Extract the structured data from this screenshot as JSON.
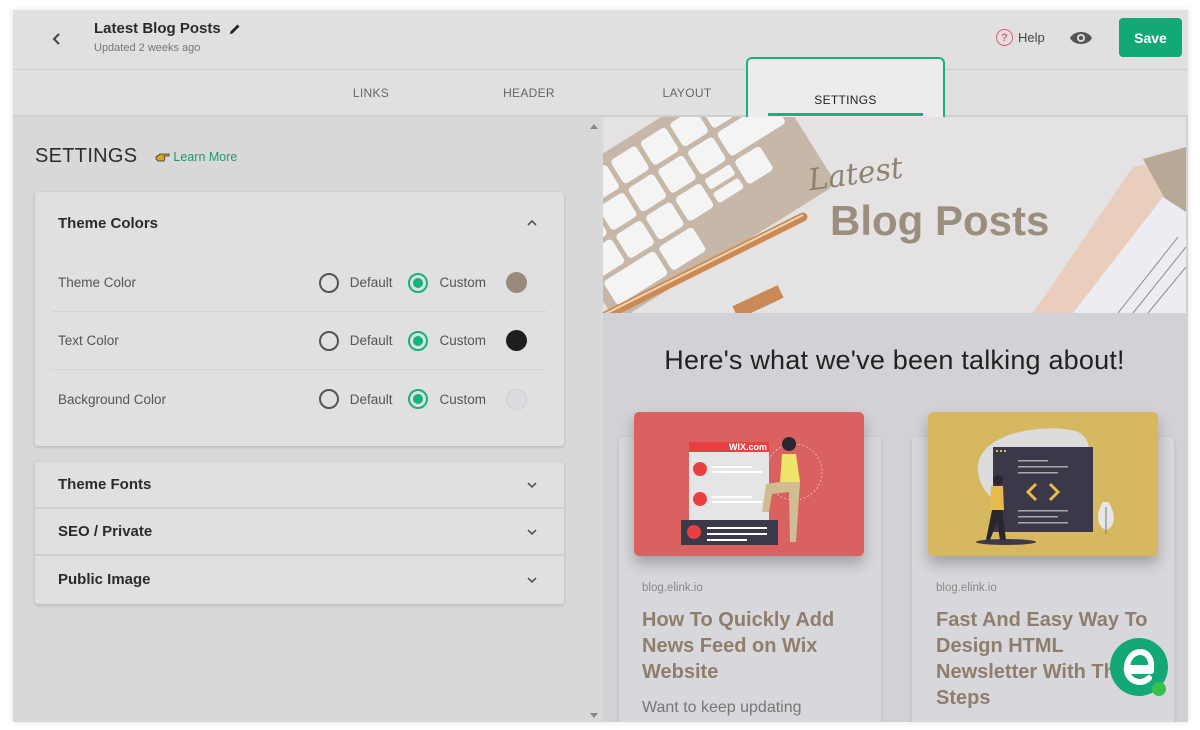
{
  "header": {
    "back_icon": "chevron-left-icon",
    "title": "Latest Blog Posts",
    "edit_icon": "pencil-icon",
    "updated": "Updated 2 weeks ago",
    "help_label": "Help",
    "help_icon": "question-circle-icon",
    "preview_icon": "eye-icon",
    "save_label": "Save"
  },
  "tabs": [
    {
      "label": "LINKS",
      "active": false
    },
    {
      "label": "HEADER",
      "active": false
    },
    {
      "label": "LAYOUT",
      "active": false
    },
    {
      "label": "SETTINGS",
      "active": true
    }
  ],
  "settings": {
    "title": "SETTINGS",
    "learn_more": "Learn More",
    "theme_colors": {
      "title": "Theme Colors",
      "expanded": true,
      "rows": [
        {
          "label": "Theme Color",
          "default_label": "Default",
          "custom_label": "Custom",
          "selected": "Custom",
          "swatch": "#9a8a7b"
        },
        {
          "label": "Text Color",
          "default_label": "Default",
          "custom_label": "Custom",
          "selected": "Custom",
          "swatch": "#1e1e1e"
        },
        {
          "label": "Background Color",
          "default_label": "Default",
          "custom_label": "Custom",
          "selected": "Custom",
          "swatch": "#dcdce0"
        }
      ]
    },
    "sections": [
      {
        "title": "Theme Fonts",
        "expanded": false
      },
      {
        "title": "SEO / Private",
        "expanded": false
      },
      {
        "title": "Public Image",
        "expanded": false
      }
    ]
  },
  "preview": {
    "hero_script": "Latest",
    "hero_title": "Blog Posts",
    "headline": "Here's what we've been talking about!",
    "posts": [
      {
        "source": "blog.elink.io",
        "title": "How To Quickly Add News Feed on Wix Website",
        "excerpt": "Want to keep updating",
        "image_label": "WIX.com",
        "image_bg": "#d9615f"
      },
      {
        "source": "blog.elink.io",
        "title": "Fast And Easy Way To Design HTML Newsletter With These Steps",
        "excerpt": "",
        "image_label": "< >",
        "image_bg": "#d6b860"
      }
    ]
  },
  "colors": {
    "accent": "#14b37d",
    "save": "#12a877",
    "post_title": "#8f7e6c"
  },
  "fab": {
    "icon": "elink-logo-icon",
    "letter": "e"
  }
}
